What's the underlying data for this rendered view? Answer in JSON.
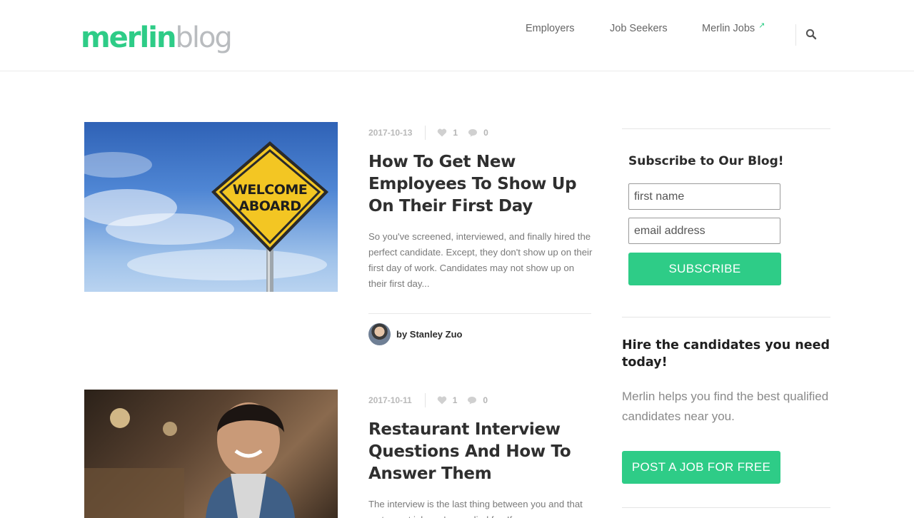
{
  "header": {
    "logo_primary": "merlin",
    "logo_secondary": "blog",
    "nav": [
      {
        "label": "Employers"
      },
      {
        "label": "Job Seekers"
      },
      {
        "label": "Merlin Jobs",
        "external_arrow": "↗"
      }
    ],
    "search_icon": "search-icon"
  },
  "posts": [
    {
      "image_sign_line1": "WELCOME",
      "image_sign_line2": "ABOARD",
      "date": "2017-10-13",
      "likes": "1",
      "comments": "0",
      "title": "How To Get New Employees To Show Up On Their First Day",
      "excerpt": "So you've screened, interviewed, and finally hired the perfect candidate. Except, they don't show up on their first day of work. Candidates may not show up on their first day...",
      "author": "by Stanley Zuo"
    },
    {
      "date": "2017-10-11",
      "likes": "1",
      "comments": "0",
      "title": "Restaurant Interview Questions And How To Answer Them",
      "excerpt": "The interview is the last thing between you and that restaurant job you've applied for. If you"
    }
  ],
  "sidebar": {
    "subscribe_title": "Subscribe to Our Blog!",
    "first_name_placeholder": "first name",
    "email_placeholder": "email address",
    "subscribe_button": "SUBSCRIBE",
    "hire_title": "Hire the candidates you need today!",
    "hire_text": "Merlin helps you find the best qualified candidates near you.",
    "post_job_button": "POST A JOB FOR FREE"
  },
  "colors": {
    "accent": "#2ecc87",
    "logo_secondary": "#b9bcbf"
  }
}
